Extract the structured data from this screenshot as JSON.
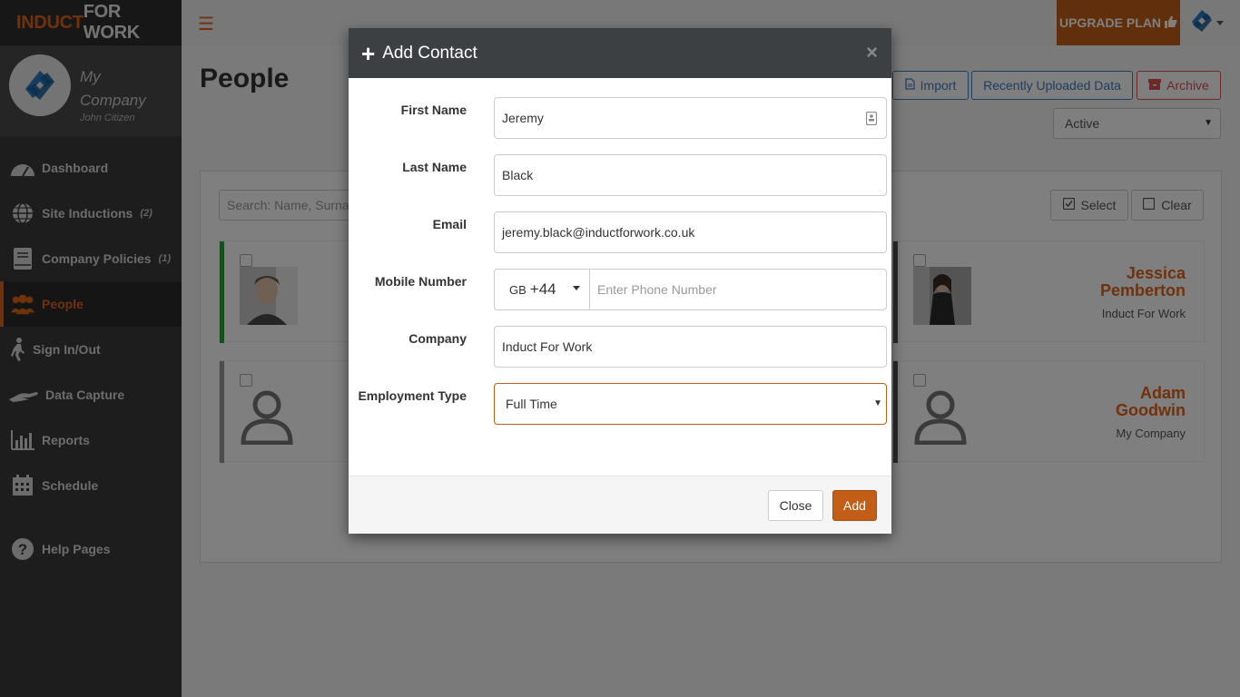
{
  "brand": {
    "part1": "INDUCT",
    "part2": "FOR WORK"
  },
  "company": {
    "name": "My Company",
    "user": "John Citizen"
  },
  "nav": [
    {
      "label": "Dashboard",
      "badge": "",
      "icon": "dashboard-icon"
    },
    {
      "label": "Site Inductions",
      "badge": "(2)",
      "icon": "globe-icon"
    },
    {
      "label": "Company Policies",
      "badge": "(1)",
      "icon": "book-icon"
    },
    {
      "label": "People",
      "badge": "",
      "icon": "people-icon"
    },
    {
      "label": "Sign In/Out",
      "badge": "",
      "icon": "walking-icon"
    },
    {
      "label": "Data Capture",
      "badge": "",
      "icon": "hand-icon"
    },
    {
      "label": "Reports",
      "badge": "",
      "icon": "bar-chart-icon"
    },
    {
      "label": "Schedule",
      "badge": "",
      "icon": "calendar-icon"
    },
    {
      "label": "Help Pages",
      "badge": "",
      "icon": "question-icon"
    }
  ],
  "topbar": {
    "upgrade_label": "UPGRADE PLAN"
  },
  "page": {
    "title": "People",
    "import_label": "Import",
    "recent_label": "Recently Uploaded Data",
    "archive_label": "Archive",
    "status_filter": "Active",
    "search_placeholder": "Search: Name, Surname",
    "select_label": "Select",
    "clear_label": "Clear"
  },
  "people": [
    {
      "first": "Jessica",
      "last": "Pemberton",
      "company": "Induct For Work"
    },
    {
      "first": "Adam",
      "last": "Goodwin",
      "company": "My Company"
    }
  ],
  "modal": {
    "title": "Add Contact",
    "fields": {
      "first_name_label": "First Name",
      "first_name_value": "Jeremy",
      "last_name_label": "Last Name",
      "last_name_value": "Black",
      "email_label": "Email",
      "email_value": "jeremy.black@inductforwork.co.uk",
      "mobile_label": "Mobile Number",
      "country_iso": "GB",
      "country_code": "+44",
      "phone_placeholder": "Enter Phone Number",
      "company_label": "Company",
      "company_value": "Induct For Work",
      "employment_label": "Employment Type",
      "employment_value": "Full Time"
    },
    "close_label": "Close",
    "add_label": "Add"
  },
  "colors": {
    "accent": "#e1621a",
    "button_orange": "#c25e17",
    "sidebar_bg": "#3b3b3b",
    "modal_header": "#3d4043",
    "link_blue": "#3a7fc4",
    "danger": "#d9534f"
  }
}
